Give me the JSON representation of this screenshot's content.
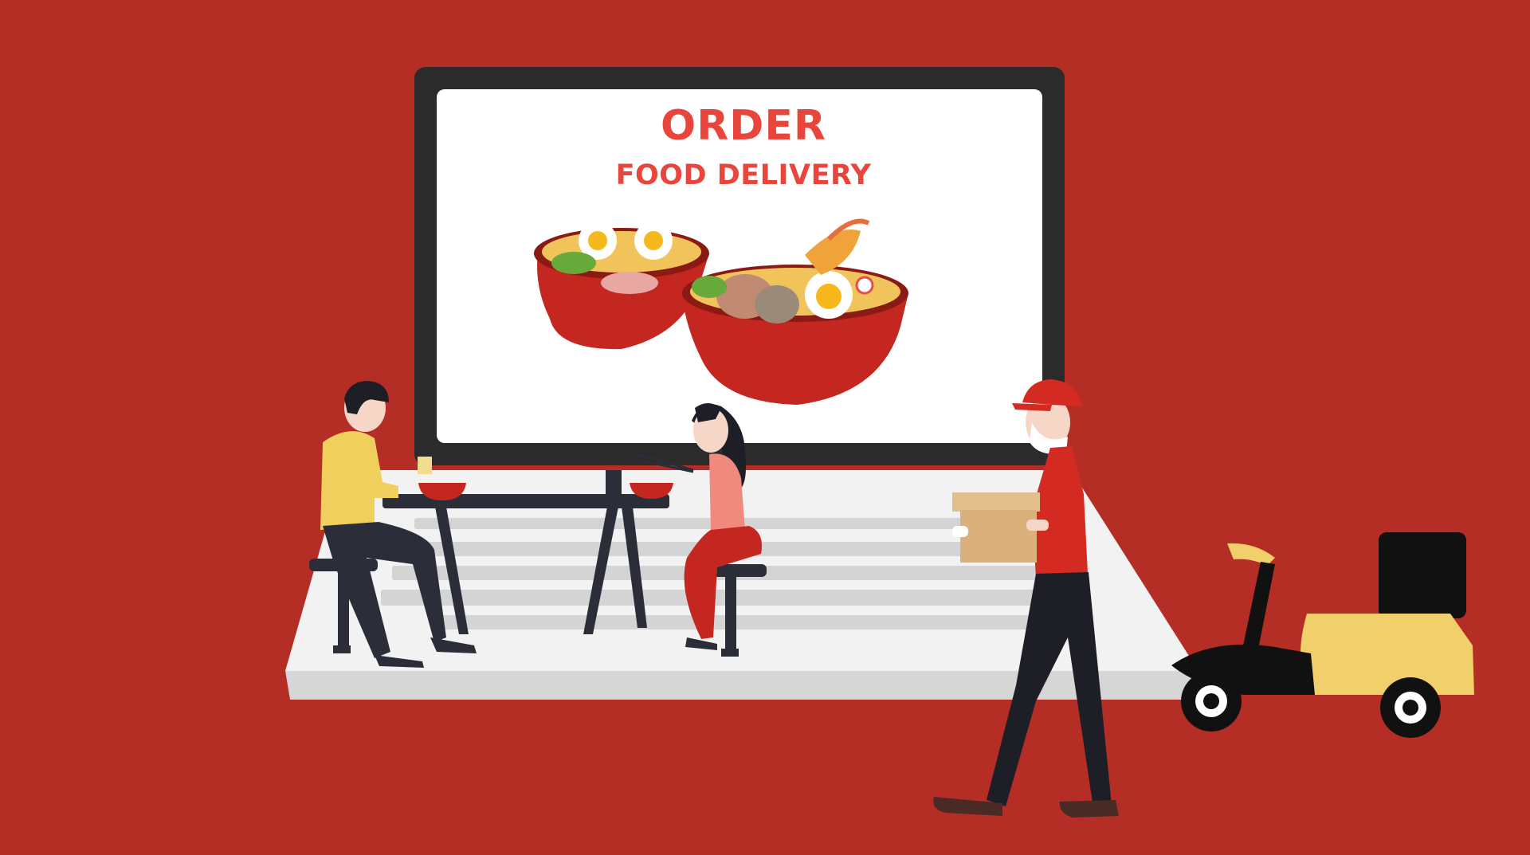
{
  "screen": {
    "title": "ORDER",
    "subtitle": "FOOD DELIVERY"
  },
  "colors": {
    "background": "#b52e26",
    "screen_text": "#e8453c",
    "laptop_frame": "#2b2b2b",
    "screen": "#ffffff",
    "keyboard": "#f2f2f2",
    "keys": "#d4d4d4",
    "bowl": "#c4271f",
    "scooter_body": "#f1cf6a",
    "shirt_man": "#f0cf5c",
    "shirt_woman": "#f08a7e",
    "courier_uniform": "#d32a22"
  },
  "icons": {
    "laptop": "laptop-icon",
    "ramen_bowl": "ramen-bowl-icon",
    "scooter": "delivery-scooter-icon",
    "parcel": "parcel-box-icon"
  }
}
